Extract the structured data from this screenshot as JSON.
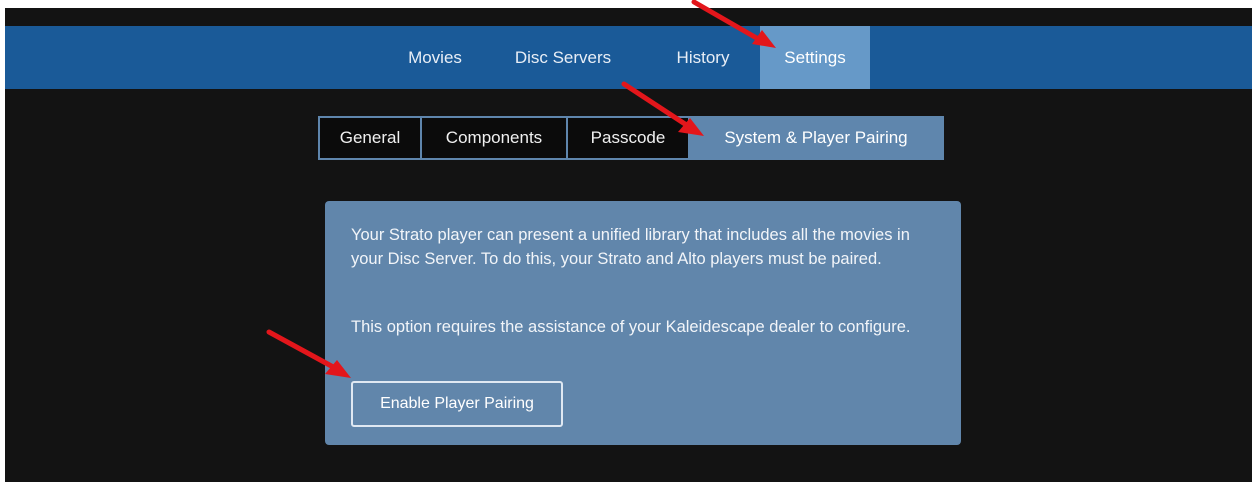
{
  "nav": {
    "items": [
      {
        "label": "Movies",
        "active": false
      },
      {
        "label": "Disc Servers",
        "active": false
      },
      {
        "label": "History",
        "active": false
      },
      {
        "label": "Settings",
        "active": true
      }
    ]
  },
  "settings_tabs": {
    "items": [
      {
        "label": "General",
        "active": false
      },
      {
        "label": "Components",
        "active": false
      },
      {
        "label": "Passcode",
        "active": false
      },
      {
        "label": "System & Player Pairing",
        "active": true
      }
    ]
  },
  "panel": {
    "paragraph1": "Your Strato player can present a unified library that includes all the movies in your Disc Server. To do this, your Strato and Alto players must be paired.",
    "paragraph2": "This option requires the assistance of your Kaleidescape dealer to configure.",
    "button_label": "Enable Player Pairing"
  },
  "colors": {
    "nav_bar": "#1a5a98",
    "nav_active": "#6699c8",
    "panel": "#6186ab",
    "tab_active": "#5f86ad",
    "background": "#131313",
    "annotation_arrow": "#e3161b"
  },
  "icons": {
    "annotation": "red-arrow-icon"
  }
}
